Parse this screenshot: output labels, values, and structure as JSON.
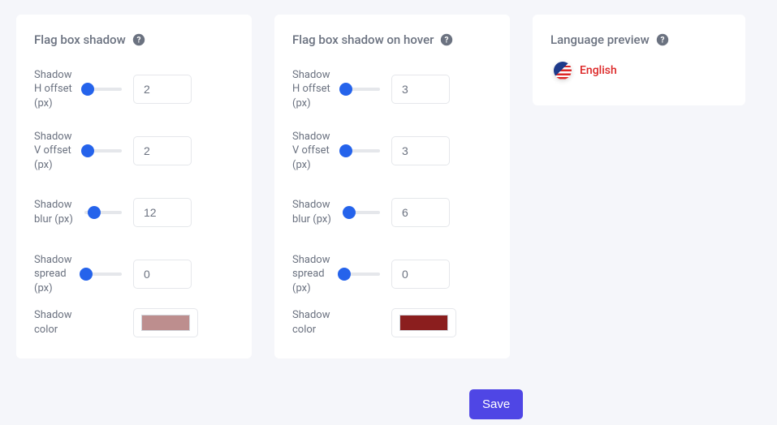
{
  "cards": {
    "shadow": {
      "title": "Flag box shadow",
      "rows": {
        "h_offset": {
          "label": "Shadow H offset (px)",
          "value": "2"
        },
        "v_offset": {
          "label": "Shadow V offset (px)",
          "value": "2"
        },
        "blur": {
          "label": "Shadow blur (px)",
          "value": "12"
        },
        "spread": {
          "label": "Shadow spread (px)",
          "value": "0"
        },
        "color": {
          "label": "Shadow color",
          "swatch": "#bd8e8e"
        }
      }
    },
    "shadow_hover": {
      "title": "Flag box shadow on hover",
      "rows": {
        "h_offset": {
          "label": "Shadow H offset (px)",
          "value": "3"
        },
        "v_offset": {
          "label": "Shadow V offset (px)",
          "value": "3"
        },
        "blur": {
          "label": "Shadow blur (px)",
          "value": "6"
        },
        "spread": {
          "label": "Shadow spread (px)",
          "value": "0"
        },
        "color": {
          "label": "Shadow color",
          "swatch": "#8b1e1e"
        }
      }
    },
    "preview": {
      "title": "Language preview",
      "language": "English"
    }
  },
  "actions": {
    "save_label": "Save"
  },
  "icons": {
    "help": "?"
  }
}
